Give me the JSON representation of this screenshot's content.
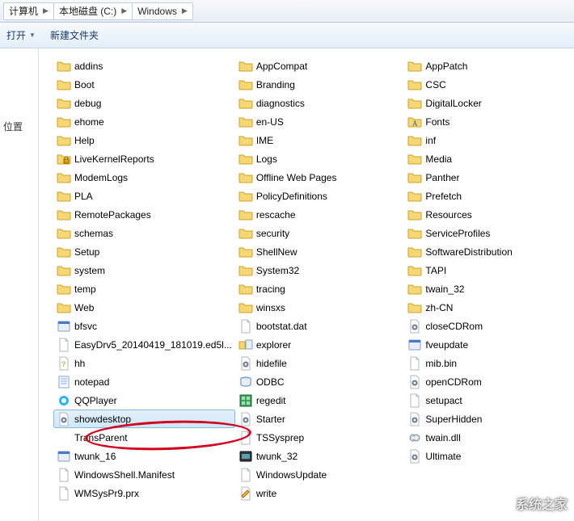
{
  "breadcrumb": {
    "root": "计算机",
    "drive": "本地磁盘 (C:)",
    "folder": "Windows"
  },
  "toolbar": {
    "open_label": "打开",
    "new_folder_label": "新建文件夹"
  },
  "sidebar": {
    "places_label": "位置"
  },
  "selected_item": "showdesktop",
  "watermark_text": "系统之家",
  "columns": [
    [
      {
        "icon": "folder",
        "label": "addins"
      },
      {
        "icon": "folder",
        "label": "Boot"
      },
      {
        "icon": "folder",
        "label": "debug"
      },
      {
        "icon": "folder",
        "label": "ehome"
      },
      {
        "icon": "folder",
        "label": "Help"
      },
      {
        "icon": "folder-lock",
        "label": "LiveKernelReports"
      },
      {
        "icon": "folder",
        "label": "ModemLogs"
      },
      {
        "icon": "folder",
        "label": "PLA"
      },
      {
        "icon": "folder",
        "label": "RemotePackages"
      },
      {
        "icon": "folder",
        "label": "schemas"
      },
      {
        "icon": "folder",
        "label": "Setup"
      },
      {
        "icon": "folder",
        "label": "system"
      },
      {
        "icon": "folder",
        "label": "temp"
      },
      {
        "icon": "folder",
        "label": "Web"
      },
      {
        "icon": "exe",
        "label": "bfsvc"
      },
      {
        "icon": "file",
        "label": "EasyDrv5_20140419_181019.ed5l..."
      },
      {
        "icon": "hh",
        "label": "hh"
      },
      {
        "icon": "notepad",
        "label": "notepad"
      },
      {
        "icon": "qq",
        "label": "QQPlayer"
      },
      {
        "icon": "script",
        "label": "showdesktop"
      },
      {
        "icon": "none",
        "label": "TransParent"
      },
      {
        "icon": "exe",
        "label": "twunk_16"
      },
      {
        "icon": "file",
        "label": "WindowsShell.Manifest"
      },
      {
        "icon": "file",
        "label": "WMSysPr9.prx"
      }
    ],
    [
      {
        "icon": "folder",
        "label": "AppCompat"
      },
      {
        "icon": "folder",
        "label": "Branding"
      },
      {
        "icon": "folder",
        "label": "diagnostics"
      },
      {
        "icon": "folder",
        "label": "en-US"
      },
      {
        "icon": "folder",
        "label": "IME"
      },
      {
        "icon": "folder",
        "label": "Logs"
      },
      {
        "icon": "folder",
        "label": "Offline Web Pages"
      },
      {
        "icon": "folder",
        "label": "PolicyDefinitions"
      },
      {
        "icon": "folder",
        "label": "rescache"
      },
      {
        "icon": "folder",
        "label": "security"
      },
      {
        "icon": "folder",
        "label": "ShellNew"
      },
      {
        "icon": "folder",
        "label": "System32"
      },
      {
        "icon": "folder",
        "label": "tracing"
      },
      {
        "icon": "folder",
        "label": "winsxs"
      },
      {
        "icon": "file",
        "label": "bootstat.dat"
      },
      {
        "icon": "explorer",
        "label": "explorer"
      },
      {
        "icon": "script",
        "label": "hidefile"
      },
      {
        "icon": "odbc",
        "label": "ODBC"
      },
      {
        "icon": "regedit",
        "label": "regedit"
      },
      {
        "icon": "script",
        "label": "Starter"
      },
      {
        "icon": "file",
        "label": "TSSysprep"
      },
      {
        "icon": "exe-dark",
        "label": "twunk_32"
      },
      {
        "icon": "file",
        "label": "WindowsUpdate"
      },
      {
        "icon": "write",
        "label": "write"
      }
    ],
    [
      {
        "icon": "folder",
        "label": "AppPatch"
      },
      {
        "icon": "folder",
        "label": "CSC"
      },
      {
        "icon": "folder",
        "label": "DigitalLocker"
      },
      {
        "icon": "fonts",
        "label": "Fonts"
      },
      {
        "icon": "folder",
        "label": "inf"
      },
      {
        "icon": "folder",
        "label": "Media"
      },
      {
        "icon": "folder",
        "label": "Panther"
      },
      {
        "icon": "folder",
        "label": "Prefetch"
      },
      {
        "icon": "folder",
        "label": "Resources"
      },
      {
        "icon": "folder",
        "label": "ServiceProfiles"
      },
      {
        "icon": "folder",
        "label": "SoftwareDistribution"
      },
      {
        "icon": "folder",
        "label": "TAPI"
      },
      {
        "icon": "folder",
        "label": "twain_32"
      },
      {
        "icon": "folder",
        "label": "zh-CN"
      },
      {
        "icon": "script",
        "label": "closeCDRom"
      },
      {
        "icon": "exe",
        "label": "fveupdate"
      },
      {
        "icon": "file",
        "label": "mib.bin"
      },
      {
        "icon": "script",
        "label": "openCDRom"
      },
      {
        "icon": "file",
        "label": "setupact"
      },
      {
        "icon": "script",
        "label": "SuperHidden"
      },
      {
        "icon": "dll",
        "label": "twain.dll"
      },
      {
        "icon": "script",
        "label": "Ultimate"
      }
    ]
  ]
}
